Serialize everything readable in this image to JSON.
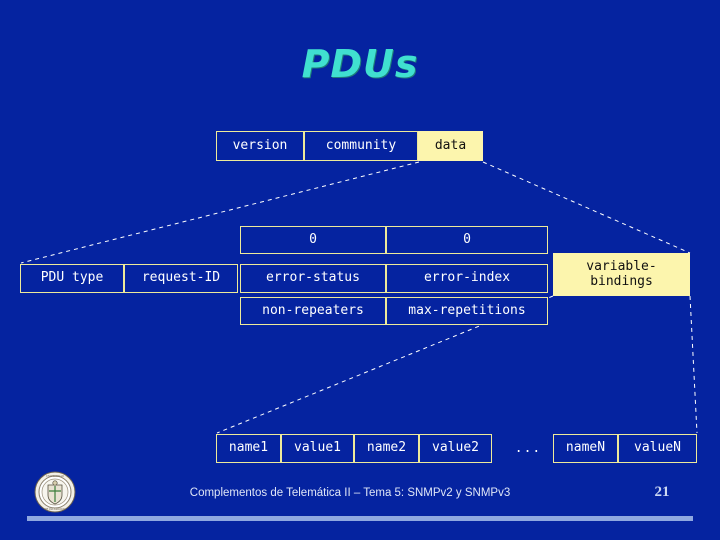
{
  "slide": {
    "title": "PDUs",
    "background_color": "#0523a0",
    "accent_color": "#40e0d0",
    "box_border_color": "#eeea9a",
    "highlight_color": "#fcf5ad"
  },
  "message_row": {
    "cells": [
      {
        "label": "version",
        "highlight": false
      },
      {
        "label": "community",
        "highlight": false
      },
      {
        "label": "data",
        "highlight": true
      }
    ]
  },
  "pdu_row": {
    "cells": [
      {
        "label": "PDU type"
      },
      {
        "label": "request-ID"
      }
    ]
  },
  "pdu_variants": {
    "row_zero": [
      {
        "label": "0"
      },
      {
        "label": "0"
      }
    ],
    "row_error": [
      {
        "label": "error-status"
      },
      {
        "label": "error-index"
      }
    ],
    "row_bulk": [
      {
        "label": "non-repeaters"
      },
      {
        "label": "max-repetitions"
      }
    ]
  },
  "varbind_box": {
    "line1": "variable-",
    "line2": "bindings"
  },
  "varbind_row": {
    "cells": [
      {
        "label": "name1"
      },
      {
        "label": "value1"
      },
      {
        "label": "name2"
      },
      {
        "label": "value2"
      }
    ],
    "ellipsis": "...",
    "tail_cells": [
      {
        "label": "nameN"
      },
      {
        "label": "valueN"
      }
    ]
  },
  "footer": {
    "text": "Complementos de Telemática II – Tema 5: SNMPv2 y SNMPv3",
    "slide_number": "21",
    "logo_name": "university-seal"
  }
}
